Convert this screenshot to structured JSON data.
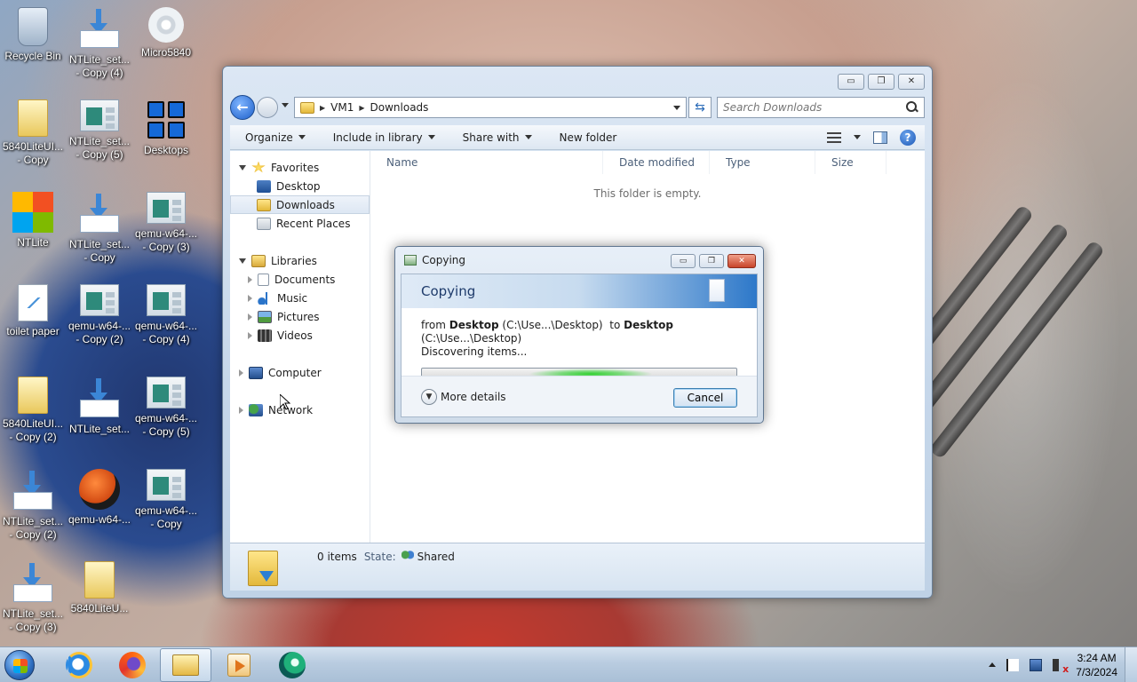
{
  "desktop": {
    "icons": [
      {
        "label": "Recycle Bin",
        "icon": "recycle-bin-icon"
      },
      {
        "label": "NTLite_set... - Copy (4)",
        "icon": "installer-icon"
      },
      {
        "label": "Micro5840",
        "icon": "disc-icon"
      },
      {
        "label": "5840LiteUI... - Copy",
        "icon": "folder-icon"
      },
      {
        "label": "NTLite_set... - Copy (5)",
        "icon": "app-window-icon"
      },
      {
        "label": "Desktops",
        "icon": "desktops-grid-icon"
      },
      {
        "label": "NTLite",
        "icon": "ntlite-icon"
      },
      {
        "label": "NTLite_set... - Copy",
        "icon": "installer-icon"
      },
      {
        "label": "qemu-w64-... - Copy (3)",
        "icon": "app-window-icon"
      },
      {
        "label": "toilet paper",
        "icon": "document-icon"
      },
      {
        "label": "qemu-w64-... - Copy (2)",
        "icon": "app-window-icon"
      },
      {
        "label": "qemu-w64-... - Copy (4)",
        "icon": "app-window-icon"
      },
      {
        "label": "5840LiteUI... - Copy (2)",
        "icon": "folder-icon"
      },
      {
        "label": "NTLite_set...",
        "icon": "installer-icon"
      },
      {
        "label": "qemu-w64-... - Copy (5)",
        "icon": "app-window-icon"
      },
      {
        "label": "NTLite_set... - Copy (2)",
        "icon": "installer-icon"
      },
      {
        "label": "qemu-w64-...",
        "icon": "qemu-icon"
      },
      {
        "label": "qemu-w64-... - Copy",
        "icon": "app-window-icon"
      },
      {
        "label": "NTLite_set... - Copy (3)",
        "icon": "installer-icon"
      },
      {
        "label": "5840LiteU...",
        "icon": "folder-icon"
      }
    ]
  },
  "explorer": {
    "window_controls": {
      "minimize": "▭",
      "maximize": "❐",
      "close": "✕"
    },
    "address": {
      "segments": [
        "VM1",
        "Downloads"
      ]
    },
    "search": {
      "placeholder": "Search Downloads"
    },
    "toolbar": {
      "organize": "Organize",
      "include_in_library": "Include in library",
      "share_with": "Share with",
      "new_folder": "New folder"
    },
    "nav": {
      "favorites": "Favorites",
      "desktop": "Desktop",
      "downloads": "Downloads",
      "recent_places": "Recent Places",
      "libraries": "Libraries",
      "documents": "Documents",
      "music": "Music",
      "pictures": "Pictures",
      "videos": "Videos",
      "computer": "Computer",
      "network": "Network"
    },
    "columns": [
      "Name",
      "Date modified",
      "Type",
      "Size"
    ],
    "empty_message": "This folder is empty.",
    "details": {
      "items": "0 items",
      "state_label": "State:",
      "state_value": "Shared"
    }
  },
  "copy_dialog": {
    "title": "Copying",
    "header": "Copying",
    "from_word": "from",
    "from_name": "Desktop",
    "from_path": "(C:\\Use...\\Desktop)",
    "to_word": "to",
    "to_name": "Desktop",
    "to_path": "(C:\\Use...\\Desktop)",
    "status": "Discovering items...",
    "more_details": "More details",
    "cancel": "Cancel"
  },
  "taskbar": {
    "time": "3:24 AM",
    "date": "7/3/2024"
  }
}
